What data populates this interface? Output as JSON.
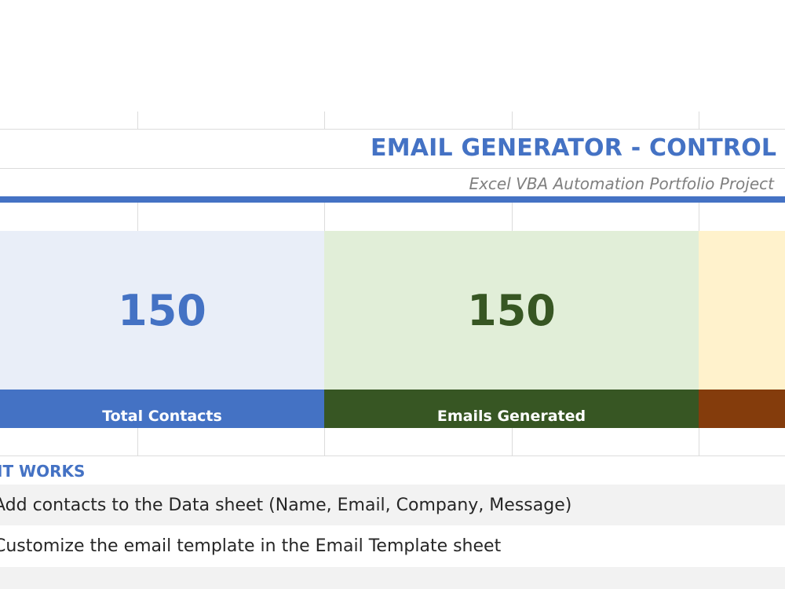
{
  "header": {
    "title": "EMAIL GENERATOR - CONTROL PA",
    "subtitle": "Excel VBA Automation Portfolio Project"
  },
  "stats": [
    {
      "value": "150",
      "label": "Total Contacts",
      "bg": "#e9eef8",
      "bar": "#4472c4",
      "text_color": "#4472c4"
    },
    {
      "value": "150",
      "label": "Emails Generated",
      "bg": "#e1eed8",
      "bar": "#375623",
      "text_color": "#375623"
    },
    {
      "value": "",
      "label": "",
      "bg": "#fff2cc",
      "bar": "#843c0c",
      "text_color": "#843c0c"
    }
  ],
  "how_it_works": {
    "heading": "IT WORKS",
    "steps": [
      "Add contacts to the Data sheet (Name, Email, Company, Message)",
      "Customize the email template in the Email Template sheet"
    ]
  },
  "colors": {
    "accent": "#4472c4",
    "grid": "#dcdcdc"
  }
}
